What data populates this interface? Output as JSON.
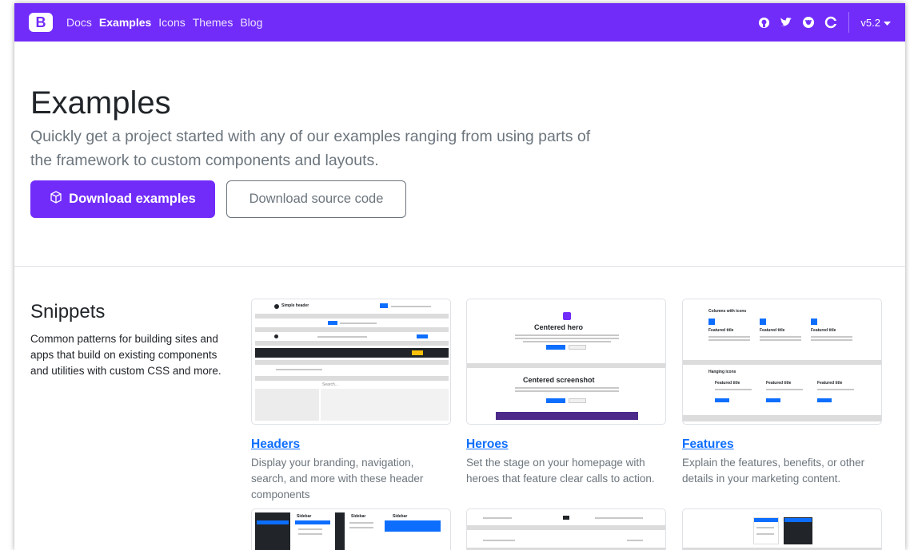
{
  "navbar": {
    "brand": "B",
    "links": [
      "Docs",
      "Examples",
      "Icons",
      "Themes",
      "Blog"
    ],
    "active_link": "Examples",
    "icons": [
      "github-icon",
      "twitter-icon",
      "opencollective-icon",
      "circle-icon"
    ],
    "version": "v5.2",
    "background": "#712cf9"
  },
  "hero": {
    "title": "Examples",
    "lead": "Quickly get a project started with any of our examples ranging from using parts of the framework to custom components and layouts.",
    "primary_button": "Download examples",
    "secondary_button": "Download source code"
  },
  "snippets": {
    "title": "Snippets",
    "description": "Common patterns for building sites and apps that build on existing components and utilities with custom CSS and more.",
    "cards": [
      {
        "title": "Headers",
        "description": "Display your branding, navigation, search, and more with these header components",
        "thumb_text": [
          "Simple header",
          "Dashboard",
          "Search..."
        ]
      },
      {
        "title": "Heroes",
        "description": "Set the stage on your homepage with heroes that feature clear calls to action.",
        "thumb_text": [
          "Centered hero",
          "Centered screenshot"
        ]
      },
      {
        "title": "Features",
        "description": "Explain the features, benefits, or other details in your marketing content.",
        "thumb_text": [
          "Columns with icons",
          "Featured title",
          "Featured title",
          "Featured title",
          "Hanging icons",
          "Featured title",
          "Featured title",
          "Featured title"
        ]
      }
    ],
    "second_row_text": [
      "Sidebar",
      "Sidebar",
      "Sidebar"
    ]
  }
}
